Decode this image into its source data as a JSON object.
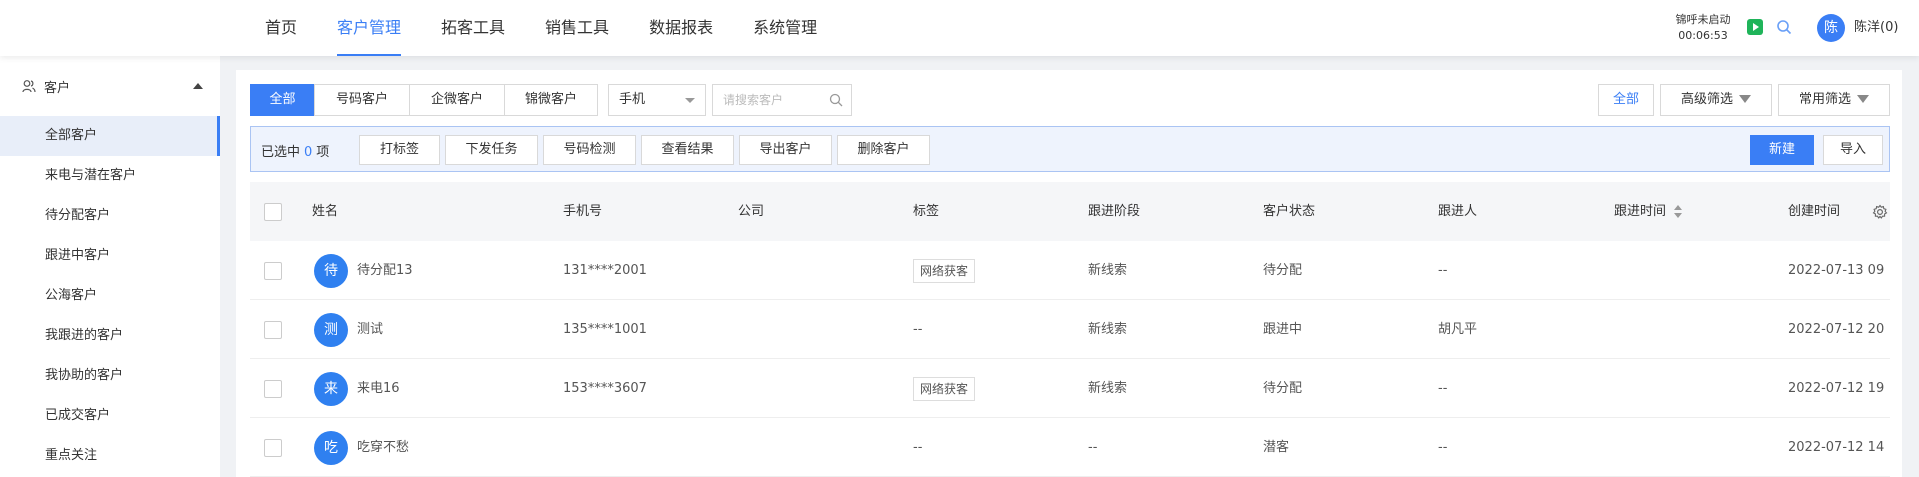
{
  "nav": {
    "items": [
      {
        "label": "首页",
        "active": false
      },
      {
        "label": "客户管理",
        "active": true
      },
      {
        "label": "拓客工具",
        "active": false
      },
      {
        "label": "销售工具",
        "active": false
      },
      {
        "label": "数据报表",
        "active": false
      },
      {
        "label": "系统管理",
        "active": false
      }
    ],
    "call_status": "锦呼未启动",
    "call_timer": "00:06:53",
    "user_avatar": "陈",
    "user_name": "陈洋(0)"
  },
  "sidebar": {
    "group_label": "客户",
    "items": [
      {
        "label": "全部客户",
        "active": true
      },
      {
        "label": "来电与潜在客户",
        "active": false
      },
      {
        "label": "待分配客户",
        "active": false
      },
      {
        "label": "跟进中客户",
        "active": false
      },
      {
        "label": "公海客户",
        "active": false
      },
      {
        "label": "我跟进的客户",
        "active": false
      },
      {
        "label": "我协助的客户",
        "active": false
      },
      {
        "label": "已成交客户",
        "active": false
      },
      {
        "label": "重点关注",
        "active": false
      }
    ]
  },
  "filters": {
    "segments": [
      "全部",
      "号码客户",
      "企微客户",
      "锦微客户"
    ],
    "select_value": "手机",
    "search_placeholder": "请搜索客户",
    "all_label": "全部",
    "advanced_label": "高级筛选",
    "common_label": "常用筛选"
  },
  "actions": {
    "selected_prefix": "已选中",
    "selected_count": "0",
    "selected_suffix": "项",
    "buttons": [
      "打标签",
      "下发任务",
      "号码检测",
      "查看结果",
      "导出客户",
      "删除客户"
    ],
    "new_label": "新建",
    "import_label": "导入"
  },
  "table": {
    "headers": [
      "姓名",
      "手机号",
      "公司",
      "标签",
      "跟进阶段",
      "客户状态",
      "跟进人",
      "跟进时间",
      "创建时间"
    ],
    "rows": [
      {
        "avatar": "待",
        "name": "待分配13",
        "phone": "131****2001",
        "company": "",
        "tag": "网络获客",
        "stage": "新线索",
        "status": "待分配",
        "owner": "--",
        "follow_time": "",
        "created": "2022-07-13 09"
      },
      {
        "avatar": "测",
        "name": "测试",
        "phone": "135****1001",
        "company": "",
        "tag": "--",
        "stage": "新线索",
        "status": "跟进中",
        "owner": "胡凡平",
        "follow_time": "",
        "created": "2022-07-12 20"
      },
      {
        "avatar": "来",
        "name": "来电16",
        "phone": "153****3607",
        "company": "",
        "tag": "网络获客",
        "stage": "新线索",
        "status": "待分配",
        "owner": "--",
        "follow_time": "",
        "created": "2022-07-12 19"
      },
      {
        "avatar": "吃",
        "name": "吃穿不愁",
        "phone": "",
        "company": "",
        "tag": "--",
        "stage": "--",
        "status": "潜客",
        "owner": "--",
        "follow_time": "",
        "created": "2022-07-12 14"
      }
    ]
  },
  "colors": {
    "accent": "#3a7ef5",
    "avatar": "#2f80f0",
    "success": "#1fb45a"
  }
}
